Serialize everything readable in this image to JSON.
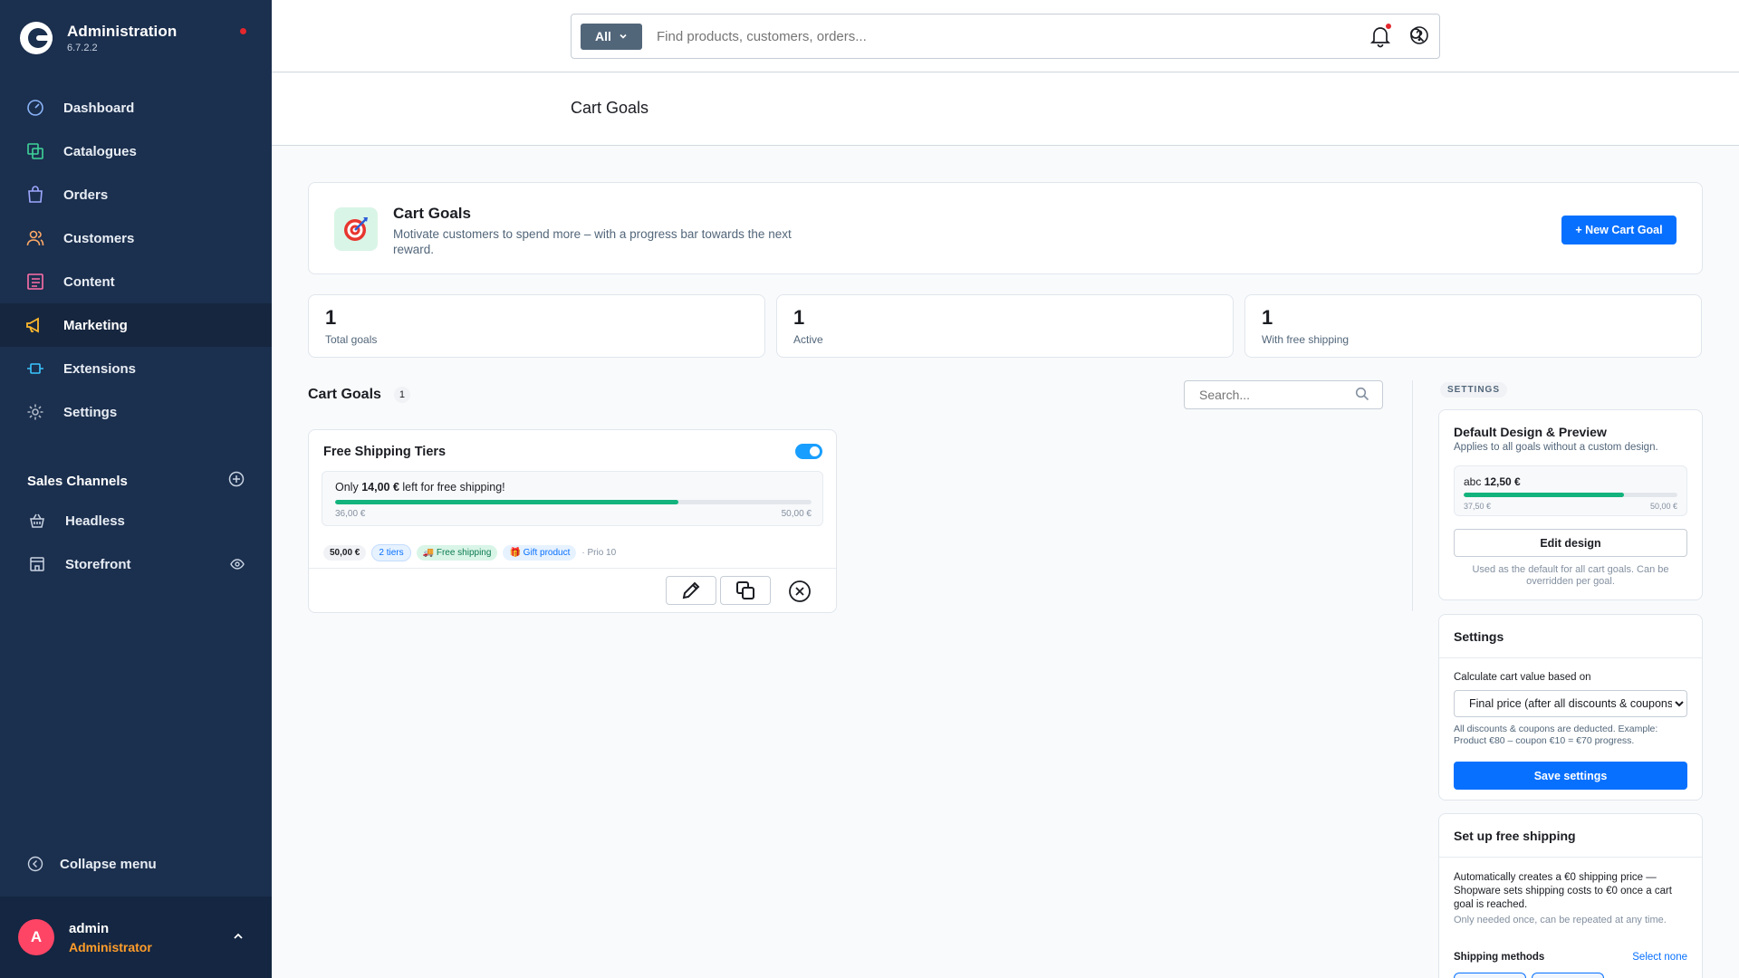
{
  "app": {
    "title": "Administration",
    "version": "6.7.2.2"
  },
  "nav": [
    {
      "label": "Dashboard",
      "icon": "dashboard-icon"
    },
    {
      "label": "Catalogues",
      "icon": "catalogue-icon"
    },
    {
      "label": "Orders",
      "icon": "orders-icon"
    },
    {
      "label": "Customers",
      "icon": "customers-icon"
    },
    {
      "label": "Content",
      "icon": "content-icon"
    },
    {
      "label": "Marketing",
      "icon": "megaphone-icon",
      "active": true
    },
    {
      "label": "Extensions",
      "icon": "extensions-icon"
    },
    {
      "label": "Settings",
      "icon": "gear-icon"
    }
  ],
  "sales_channels": {
    "title": "Sales Channels",
    "items": [
      {
        "label": "Headless"
      },
      {
        "label": "Storefront"
      }
    ]
  },
  "collapse_label": "Collapse menu",
  "user": {
    "initial": "A",
    "name": "admin",
    "role": "Administrator"
  },
  "search": {
    "type": "All",
    "placeholder": "Find products, customers, orders..."
  },
  "page_title": "Cart Goals",
  "intro": {
    "title": "Cart Goals",
    "description": "Motivate customers to spend more – with a progress bar towards the next reward.",
    "new_button": "+ New Cart Goal"
  },
  "stats": [
    {
      "value": "1",
      "label": "Total goals"
    },
    {
      "value": "1",
      "label": "Active"
    },
    {
      "value": "1",
      "label": "With free shipping"
    }
  ],
  "list": {
    "title": "Cart Goals",
    "count": "1",
    "search_placeholder": "Search..."
  },
  "goal": {
    "title": "Free Shipping Tiers",
    "enabled": true,
    "preview": {
      "prefix": "Only ",
      "amount": "14,00 €",
      "suffix": " left for free shipping!",
      "min": "36,00 €",
      "max": "50,00 €",
      "progress": 0.72
    },
    "tags": {
      "threshold": "50,00 €",
      "tiers": "2 tiers",
      "free_shipping": "🚚 Free shipping",
      "gift": "🎁 Gift product",
      "prio": "· Prio 10"
    }
  },
  "settings_label": "SETTINGS",
  "design": {
    "title": "Default Design & Preview",
    "subtitle": "Applies to all goals without a custom design.",
    "preview": {
      "prefix": "abc ",
      "amount": "12,50 €",
      "min": "37,50 €",
      "max": "50,00 €",
      "progress": 0.75
    },
    "edit_button": "Edit design",
    "note": "Used as the default for all cart goals. Can be overridden per goal."
  },
  "settings": {
    "title": "Settings",
    "calc_label": "Calculate cart value based on",
    "calc_value": "Final price (after all discounts & coupons)",
    "calc_note": "All discounts & coupons are deducted. Example: Product €80 – coupon €10 = €70 progress.",
    "save_button": "Save settings"
  },
  "free_shipping": {
    "title": "Set up free shipping",
    "description": "Automatically creates a €0 shipping price — Shopware sets shipping costs to €0 once a cart goal is reached.",
    "note": "Only needed once, can be repeated at any time.",
    "methods_label": "Shipping methods",
    "select_none": "Select none"
  },
  "colors": {
    "sidebar": "#1b2f4e",
    "primary": "#0870ff",
    "success": "#12b37c",
    "toggle": "#189eff",
    "user_role": "#ff9d2b"
  }
}
